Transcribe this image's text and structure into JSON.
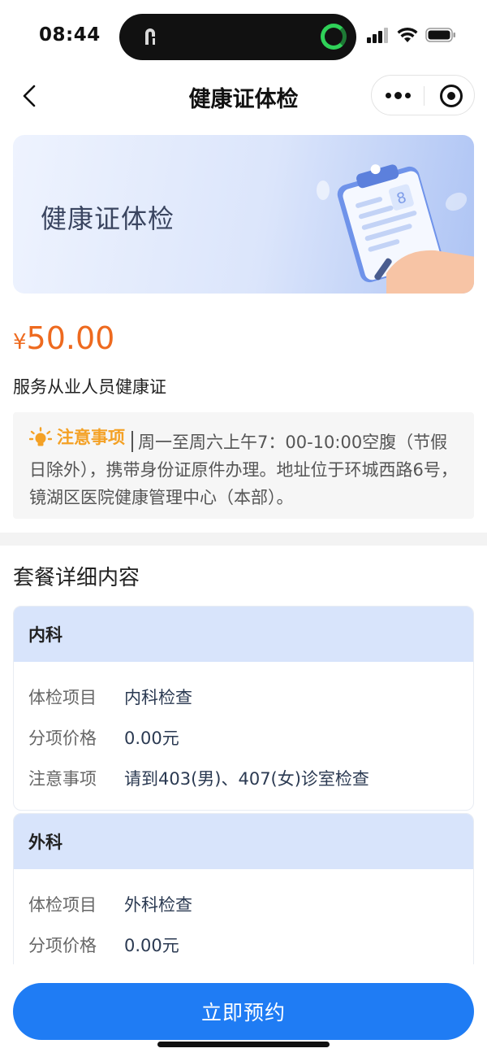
{
  "status_bar": {
    "time": "08:44"
  },
  "nav": {
    "title": "健康证体检"
  },
  "banner": {
    "title": "健康证体检"
  },
  "product": {
    "price_symbol": "¥",
    "price": "50.00",
    "name": "服务从业人员健康证"
  },
  "notice": {
    "tag": "注意事项",
    "text": "周一至周六上午7：00-10:00空腹（节假日除外），携带身份证原件办理。地址位于环城西路6号，镜湖区医院健康管理中心（本部）。"
  },
  "package": {
    "title": "套餐详细内容",
    "sections": [
      {
        "name": "内科",
        "rows": [
          {
            "label": "体检项目",
            "value": "内科检查"
          },
          {
            "label": "分项价格",
            "value": "0.00元"
          },
          {
            "label": "注意事项",
            "value": "请到403(男)、407(女)诊室检查"
          }
        ]
      },
      {
        "name": "外科",
        "rows": [
          {
            "label": "体检项目",
            "value": "外科检查"
          },
          {
            "label": "分项价格",
            "value": "0.00元"
          }
        ]
      }
    ]
  },
  "actions": {
    "book_label": "立即预约"
  },
  "colors": {
    "accent": "#1f7cf4",
    "price": "#ee6a1f",
    "notice_tag": "#f4a125",
    "card_header": "#d8e4fb"
  }
}
